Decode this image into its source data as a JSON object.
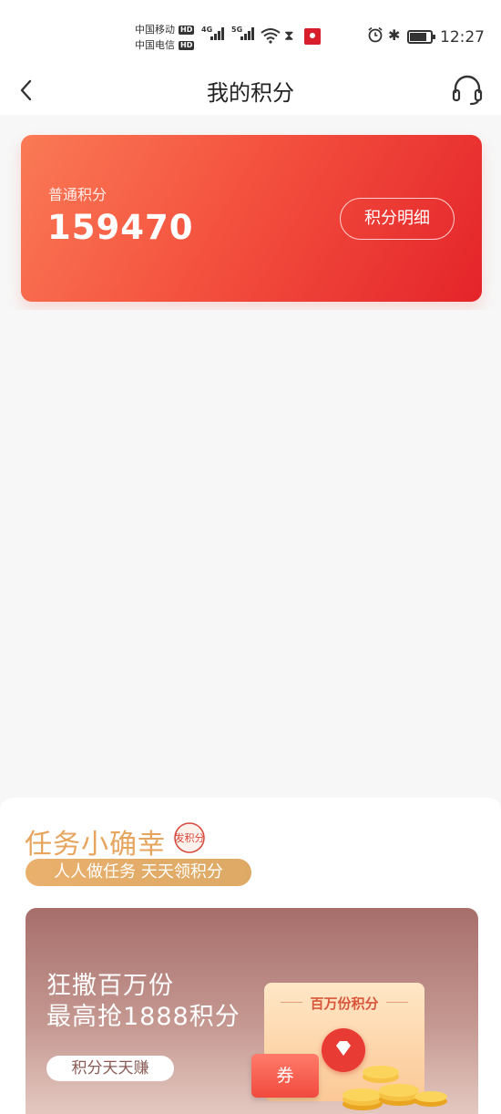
{
  "status_bar": {
    "carrier_1": "中国移动",
    "carrier_2": "中国电信",
    "hd_badge": "HD",
    "network_1": "4G",
    "network_2": "5G",
    "time": "12:27"
  },
  "nav": {
    "title": "我的积分",
    "back_icon": "chevron-left-icon",
    "service_icon": "headset-icon"
  },
  "points_card": {
    "label": "普通积分",
    "value": "159470",
    "detail_button": "积分明细"
  },
  "task_section": {
    "title": "任务小确幸",
    "stamp_text": "发积分",
    "subtitle": "人人做任务 天天领积分",
    "banner": {
      "line1": "狂撒百万份",
      "line2": "最高抢1888积分",
      "button": "积分天天赚",
      "card_label": "百万份积分",
      "voucher": "券"
    }
  },
  "colors": {
    "card_gradient_start": "#fa7a55",
    "card_gradient_end": "#e4242a",
    "task_title": "#e6a45c",
    "subtitle_pill": "#e9b06c",
    "banner_top": "#a76e6a"
  }
}
